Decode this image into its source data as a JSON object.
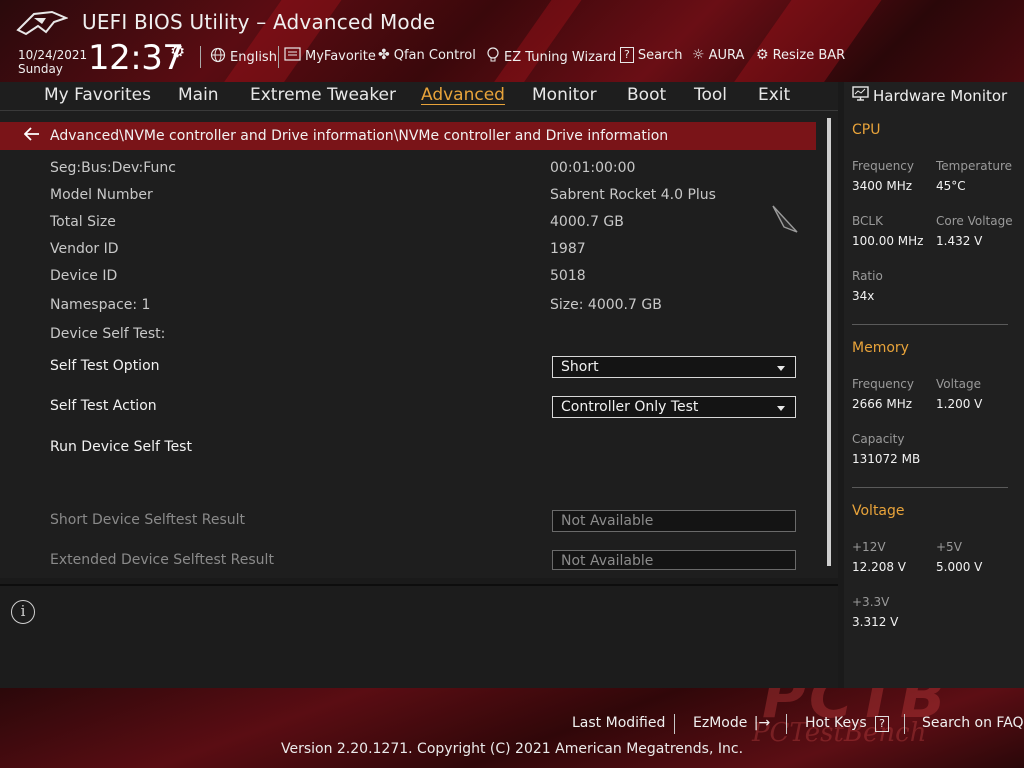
{
  "header": {
    "title": "UEFI BIOS Utility – Advanced Mode",
    "date": "10/24/2021",
    "day": "Sunday",
    "time": "12:37",
    "toolbar": [
      {
        "label": "English",
        "icon": "globe-icon"
      },
      {
        "label": "MyFavorite",
        "icon": "favorite-list-icon"
      },
      {
        "label": "Qfan Control",
        "icon": "fan-icon"
      },
      {
        "label": "EZ Tuning Wizard",
        "icon": "lightbulb-icon"
      },
      {
        "label": "Search",
        "icon": "search-question-icon"
      },
      {
        "label": "AURA",
        "icon": "aura-light-icon"
      },
      {
        "label": "Resize BAR",
        "icon": "resize-bar-icon"
      }
    ]
  },
  "nav": {
    "items": [
      "My Favorites",
      "Main",
      "Extreme Tweaker",
      "Advanced",
      "Monitor",
      "Boot",
      "Tool",
      "Exit"
    ],
    "active": "Advanced"
  },
  "breadcrumb": "Advanced\\NVMe controller and Drive information\\NVMe controller and Drive information",
  "info_rows": [
    {
      "label": "Seg:Bus:Dev:Func",
      "value": "00:01:00:00"
    },
    {
      "label": "Model Number",
      "value": "Sabrent Rocket 4.0 Plus"
    },
    {
      "label": "Total Size",
      "value": "4000.7 GB"
    },
    {
      "label": "Vendor ID",
      "value": "1987"
    },
    {
      "label": "Device ID",
      "value": "5018"
    },
    {
      "label": "Namespace: 1",
      "value": "Size: 4000.7 GB"
    }
  ],
  "self_test_heading": "Device Self Test:",
  "self_test_option": {
    "label": "Self Test Option",
    "value": "Short"
  },
  "self_test_action": {
    "label": "Self Test Action",
    "value": "Controller Only Test"
  },
  "run_self_test": "Run Device Self Test",
  "short_result": {
    "label": "Short Device Selftest Result",
    "value": "Not Available"
  },
  "extended_result": {
    "label": "Extended Device Selftest Result",
    "value": "Not Available"
  },
  "hardware_monitor": {
    "title": "Hardware Monitor",
    "cpu": {
      "heading": "CPU",
      "frequency_label": "Frequency",
      "frequency": "3400 MHz",
      "temperature_label": "Temperature",
      "temperature": "45°C",
      "bclk_label": "BCLK",
      "bclk": "100.00 MHz",
      "core_voltage_label": "Core Voltage",
      "core_voltage": "1.432 V",
      "ratio_label": "Ratio",
      "ratio": "34x"
    },
    "memory": {
      "heading": "Memory",
      "frequency_label": "Frequency",
      "frequency": "2666 MHz",
      "voltage_label": "Voltage",
      "voltage": "1.200 V",
      "capacity_label": "Capacity",
      "capacity": "131072 MB"
    },
    "voltage": {
      "heading": "Voltage",
      "v12_label": "+12V",
      "v12": "12.208 V",
      "v5_label": "+5V",
      "v5": "5.000 V",
      "v33_label": "+3.3V",
      "v33": "3.312 V"
    }
  },
  "footer": {
    "last_modified": "Last Modified",
    "ezmode": "EzMode",
    "hot_keys": "Hot Keys",
    "hot_keys_key": "?",
    "search_faq": "Search on FAQ",
    "copyright": "Version 2.20.1271. Copyright (C) 2021 American Megatrends, Inc.",
    "watermark": "PCTB",
    "watermark_sub": "PCTestBench"
  },
  "colors": {
    "accent": "#e8a33a",
    "breadcrumb_bg": "#7a1418",
    "panel_bg": "#1e1e1e"
  }
}
